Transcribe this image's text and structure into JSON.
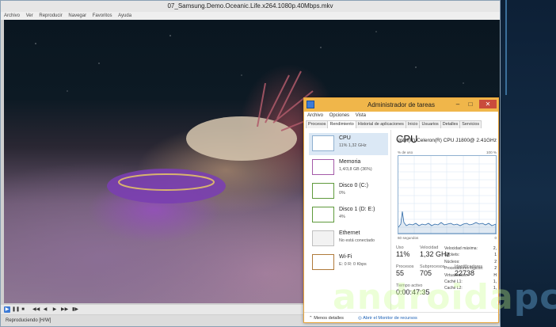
{
  "player": {
    "title": "07_Samsung.Demo.Oceanic.Life.x264.1080p.40Mbps.mkv",
    "menu": [
      "Archivo",
      "Ver",
      "Reproducir",
      "Navegar",
      "Favoritos",
      "Ayuda"
    ],
    "status": "Reproduciendo [H/W]"
  },
  "taskmanager": {
    "title": "Administrador de tareas",
    "window_buttons": [
      "–",
      "□",
      "✕"
    ],
    "menu": [
      "Archivo",
      "Opciones",
      "Vista"
    ],
    "tabs": [
      "Procesos",
      "Rendimiento",
      "Historial de aplicaciones",
      "Inicio",
      "Usuarios",
      "Detalles",
      "Servicios"
    ],
    "active_tab": "Rendimiento",
    "sidebar": [
      {
        "name": "CPU",
        "sub": "11% 1,32 GHz"
      },
      {
        "name": "Memoria",
        "sub": "1,4/3,8 GB (36%)"
      },
      {
        "name": "Disco 0 (C:)",
        "sub": "0%"
      },
      {
        "name": "Disco 1 (D: E:)",
        "sub": "4%"
      },
      {
        "name": "Ethernet",
        "sub": "No está conectado"
      },
      {
        "name": "Wi-Fi",
        "sub": "E: 0 R: 0 Kbps"
      }
    ],
    "main": {
      "heading": "CPU",
      "cpu_name": "Intel(R) Celeron(R) CPU J1800@ 2.41GHz",
      "graph_top_left": "% de uso",
      "graph_top_right": "100 %",
      "graph_bottom_left": "60 segundos",
      "graph_bottom_right": "0",
      "uso_label": "Uso",
      "uso_value": "11%",
      "velocidad_label": "Velocidad",
      "velocidad_value": "1,32 GHz",
      "procesos_label": "Procesos",
      "procesos_value": "55",
      "subprocesos_label": "Subprocesos",
      "subprocesos_value": "705",
      "identificadores_label": "Identificadores",
      "identificadores_value": "22738",
      "tiempo_label": "Tiempo activo",
      "tiempo_value": "0:00:47:35",
      "specs": [
        {
          "k": "Velocidad máxima:",
          "v": "2,"
        },
        {
          "k": "Sockets:",
          "v": "1"
        },
        {
          "k": "Núcleos:",
          "v": "2"
        },
        {
          "k": "Procesadores lógicos:",
          "v": "2"
        },
        {
          "k": "Virtualización:",
          "v": "H"
        },
        {
          "k": "Caché L1:",
          "v": "1,"
        },
        {
          "k": "Caché L2:",
          "v": "1,"
        }
      ]
    },
    "footer": {
      "less": "Menos detalles",
      "link": "Abrir el Monitor de recursos"
    }
  },
  "watermark": {
    "a": "androida",
    "b": "pc"
  },
  "colors": {
    "accent": "#f0b64a",
    "graph_line": "#2e6aa8",
    "selected": "#dbe8f5"
  }
}
